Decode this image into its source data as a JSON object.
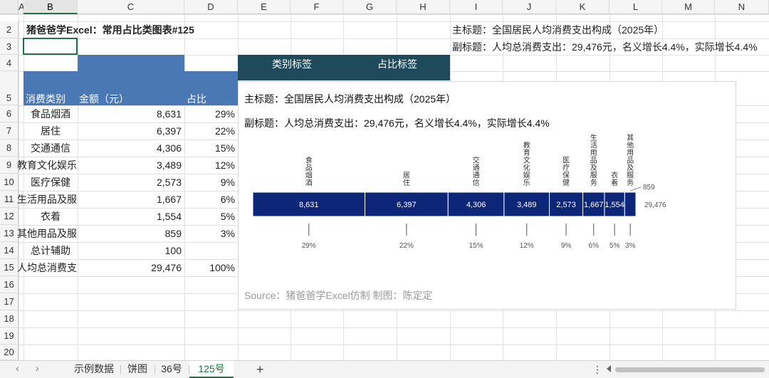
{
  "columns": [
    "A",
    "B",
    "C",
    "D",
    "E",
    "F",
    "G",
    "H",
    "I",
    "J",
    "K",
    "L",
    "M",
    "N"
  ],
  "active_column": "B",
  "rows": [
    "2",
    "3",
    "4",
    "5",
    "6",
    "7",
    "8",
    "9",
    "10",
    "11",
    "12",
    "13",
    "14",
    "15",
    "16",
    "17",
    "18",
    "19",
    "20"
  ],
  "sheet_title": "猪爸爸学Excel：常用占比类图表#125",
  "main_title_cell": "主标题：全国居民人均消费支出构成（2025年）",
  "sub_title_cell": "副标题：人均总消费支出：29,476元，名义增长4.4%，实际增长4.4%",
  "table": {
    "header": {
      "category": "消费类别",
      "amount": "金额（元）",
      "pct": "占比"
    },
    "rows": [
      {
        "category": "食品烟酒",
        "amount": "8,631",
        "pct": "29%"
      },
      {
        "category": "居住",
        "amount": "6,397",
        "pct": "22%"
      },
      {
        "category": "交通通信",
        "amount": "4,306",
        "pct": "15%"
      },
      {
        "category": "教育文化娱乐",
        "amount": "3,489",
        "pct": "12%"
      },
      {
        "category": "医疗保健",
        "amount": "2,573",
        "pct": "9%"
      },
      {
        "category": "生活用品及服务",
        "amount": "1,667",
        "pct": "6%"
      },
      {
        "category": "衣着",
        "amount": "1,554",
        "pct": "5%"
      },
      {
        "category": "其他用品及服务",
        "amount": "859",
        "pct": "3%"
      },
      {
        "category": "总计辅助",
        "amount": "100",
        "pct": ""
      },
      {
        "category": "人均总消费支出",
        "amount": "29,476",
        "pct": "100%"
      }
    ]
  },
  "band_labels": {
    "category": "类别标签",
    "pct": "占比标签"
  },
  "chart": {
    "title": "主标题：全国居民人均消费支出构成（2025年）",
    "subtitle": "副标题：人均总消费支出：29,476元，名义增长4.4%，实际增长4.4%",
    "total_label": "29,476",
    "source": "Source：猪爸爸学Excel仿制   制图：陈定定",
    "bar_color": "#0d2677",
    "bar_text_color": "#ffffff"
  },
  "chart_data": {
    "type": "bar",
    "orientation": "horizontal-stacked",
    "categories": [
      "食品烟酒",
      "居住",
      "交通通信",
      "教育文化娱乐",
      "医疗保健",
      "生活用品及服务",
      "衣着",
      "其他用品及服务"
    ],
    "values": [
      8631,
      6397,
      4306,
      3489,
      2573,
      1667,
      1554,
      859
    ],
    "value_labels": [
      "8,631",
      "6,397",
      "4,306",
      "3,489",
      "2,573",
      "1,667",
      "1,554",
      "859"
    ],
    "percent_labels": [
      "29%",
      "22%",
      "15%",
      "12%",
      "9%",
      "6%",
      "5%",
      "3%"
    ],
    "total": 29476,
    "title": "主标题：全国居民人均消费支出构成（2025年）",
    "subtitle": "副标题：人均总消费支出：29,476元，名义增长4.4%，实际增长4.4%"
  },
  "tabs": [
    {
      "label": "示例数据"
    },
    {
      "label": "饼图"
    },
    {
      "label": "36号"
    },
    {
      "label": "125号"
    }
  ],
  "active_tab": "125号",
  "add_sheet": "+",
  "more_menu": "⋮",
  "nav_prev": "‹",
  "nav_next": "›"
}
